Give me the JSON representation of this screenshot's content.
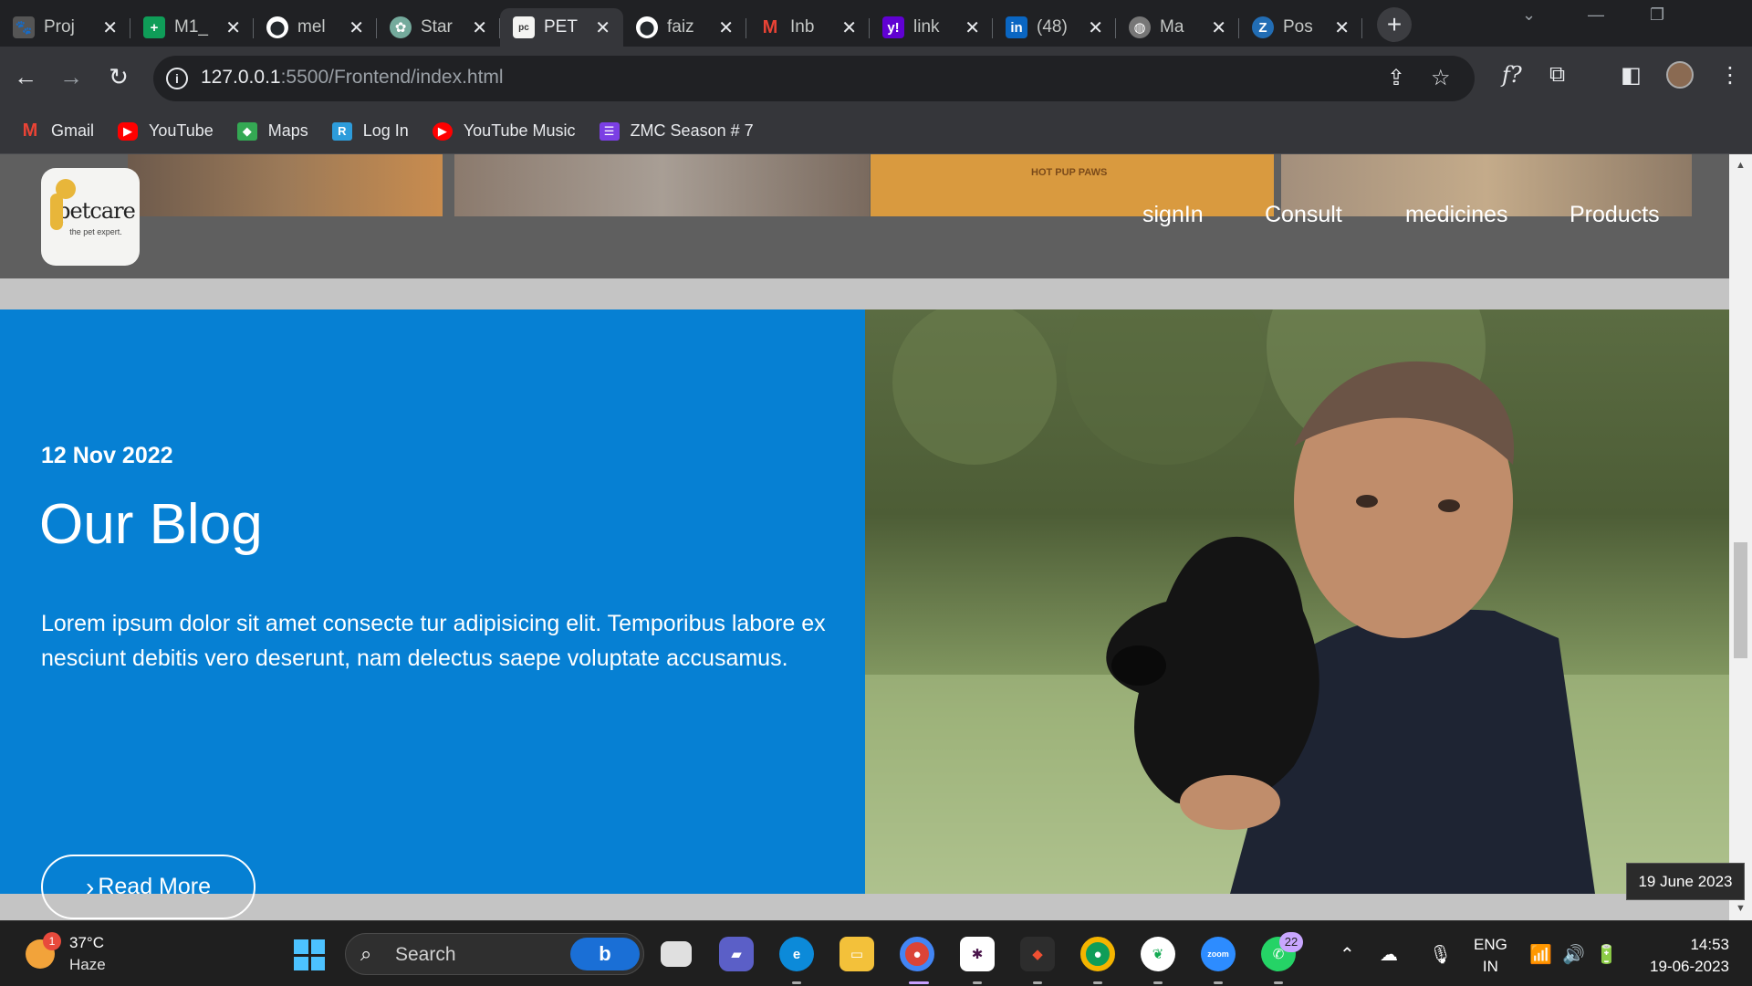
{
  "browser": {
    "tabs": [
      {
        "label": "Proj",
        "favicon": "paw-icon",
        "color": "#555555"
      },
      {
        "label": "M1_",
        "favicon": "sheets-icon",
        "color": "#0f9d58"
      },
      {
        "label": "mel",
        "favicon": "github-icon",
        "color": "#24292e"
      },
      {
        "label": "Star",
        "favicon": "chatgpt-icon",
        "color": "#74aa9c"
      },
      {
        "label": "PET",
        "favicon": "petcare-icon",
        "color": "#f4f4f2",
        "active": true
      },
      {
        "label": "faiz",
        "favicon": "github-icon",
        "color": "#24292e"
      },
      {
        "label": "Inb",
        "favicon": "gmail-icon",
        "color": "#ea4335"
      },
      {
        "label": "link",
        "favicon": "yahoo-icon",
        "color": "#6001d2"
      },
      {
        "label": "(48)",
        "favicon": "linkedin-icon",
        "color": "#0a66c2"
      },
      {
        "label": "Ma",
        "favicon": "globe-icon",
        "color": "#777777"
      },
      {
        "label": "Pos",
        "favicon": "zoho-icon",
        "color": "#226db4"
      }
    ],
    "url_host": "127.0.0.1",
    "url_rest": ":5500/Frontend/index.html",
    "bookmarks": [
      {
        "label": "Gmail",
        "icon": "gmail-icon",
        "color": "#ea4335"
      },
      {
        "label": "YouTube",
        "icon": "youtube-icon",
        "color": "#ff0000"
      },
      {
        "label": "Maps",
        "icon": "maps-icon",
        "color": "#34a853"
      },
      {
        "label": "Log In",
        "icon": "login-icon",
        "color": "#2d9cdb"
      },
      {
        "label": "YouTube Music",
        "icon": "youtube-music-icon",
        "color": "#ff0000"
      },
      {
        "label": "ZMC Season # 7",
        "icon": "list-icon",
        "color": "#7b3fe4"
      }
    ]
  },
  "site": {
    "logo_name": "petcare",
    "logo_tagline": "the pet expert.",
    "nav": [
      "signIn",
      "Consult",
      "medicines",
      "Products"
    ],
    "blog": {
      "date": "12 Nov 2022",
      "title": "Our Blog",
      "text": "Lorem ipsum dolor sit amet consecte tur adipisicing elit. Temporibus labore ex nesciunt debitis vero deserunt, nam delectus saepe voluptate accusamus.",
      "button": "Read More"
    },
    "banner_text": "HOT PUP PAWS"
  },
  "tooltip": "19 June 2023",
  "taskbar": {
    "weather_temp": "37°C",
    "weather_cond": "Haze",
    "weather_badge": "1",
    "search_label": "Search",
    "whatsapp_badge": "22",
    "lang_1": "ENG",
    "lang_2": "IN",
    "time": "14:53",
    "date": "19-06-2023"
  }
}
